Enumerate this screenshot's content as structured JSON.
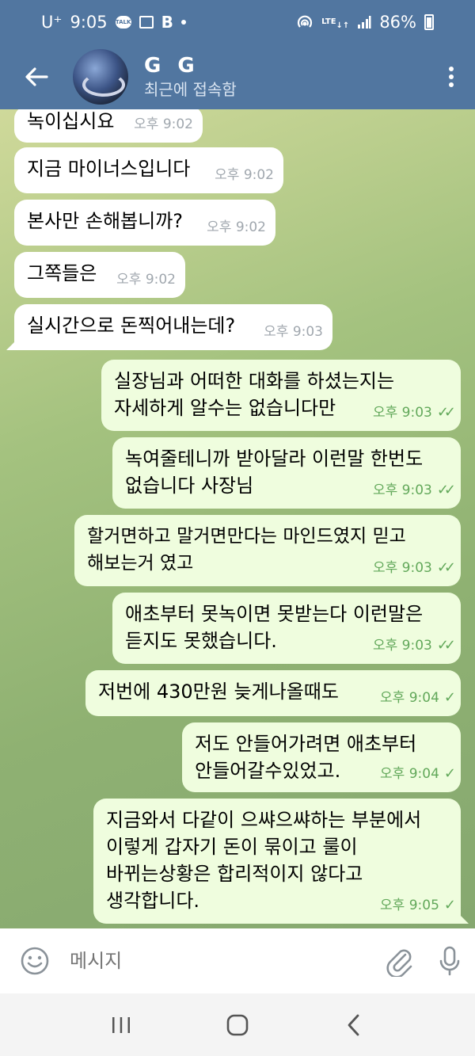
{
  "status_bar": {
    "carrier": "U⁺",
    "time": "9:05",
    "network": "LTE",
    "battery": "86%"
  },
  "header": {
    "title": "G G",
    "subtitle": "최근에 접속함"
  },
  "messages": [
    {
      "dir": "in",
      "text": "녹이십시요",
      "time": "오후 9:02"
    },
    {
      "dir": "in",
      "text": "지금 마이너스입니다",
      "time": "오후 9:02"
    },
    {
      "dir": "in",
      "text": "본사만 손해봅니까?",
      "time": "오후 9:02"
    },
    {
      "dir": "in",
      "text": "그쪽들은",
      "time": "오후 9:02"
    },
    {
      "dir": "in",
      "text": "실시간으로 돈찍어내는데?",
      "time": "오후 9:03"
    },
    {
      "dir": "out",
      "text": "실장님과 어떠한 대화를 하셨는지는\n자세하게 알수는 없습니다만",
      "time": "오후 9:03",
      "status": "read"
    },
    {
      "dir": "out",
      "text": "녹여줄테니까 받아달라 이런말 한번도\n없습니다 사장님",
      "time": "오후 9:03",
      "status": "read"
    },
    {
      "dir": "out",
      "text": "할거면하고 말거면만다는 마인드였지 믿고\n해보는거 였고",
      "time": "오후 9:03",
      "status": "read"
    },
    {
      "dir": "out",
      "text": "애초부터 못녹이면 못받는다 이런말은\n듣지도 못했습니다.",
      "time": "오후 9:03",
      "status": "read"
    },
    {
      "dir": "out",
      "text": "저번에 430만원 늦게나올때도",
      "time": "오후 9:04",
      "status": "sent"
    },
    {
      "dir": "out",
      "text": "저도 안들어가려면 애초부터\n안들어갈수있었고.",
      "time": "오후 9:04",
      "status": "sent"
    },
    {
      "dir": "out",
      "text": "지금와서 다같이 으쌰으쌰하는 부분에서\n이렇게 갑자기 돈이 묶이고 룰이\n바뀌는상황은 합리적이지 않다고\n생각합니다.",
      "time": "오후 9:05",
      "status": "sent"
    }
  ],
  "input": {
    "placeholder": "메시지"
  },
  "colors": {
    "header": "#5176a0",
    "incoming_bubble": "#ffffff",
    "outgoing_bubble": "#effdde",
    "check": "#62a85a"
  }
}
